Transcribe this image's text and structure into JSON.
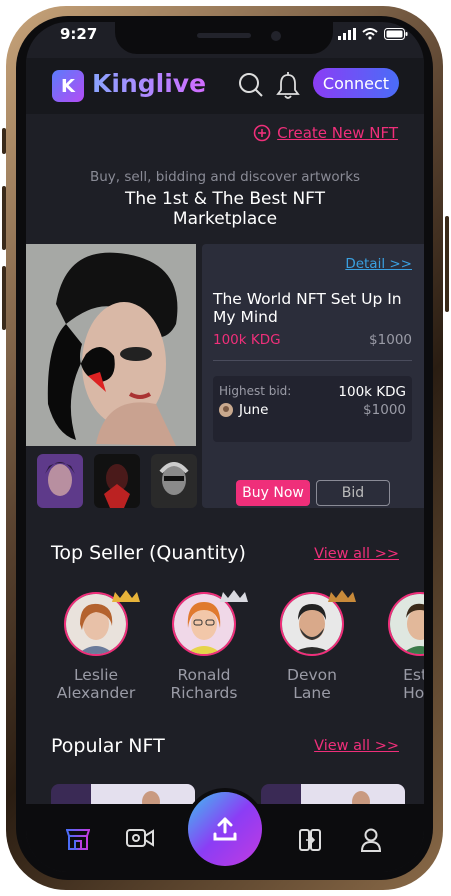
{
  "status_bar": {
    "time": "9:27"
  },
  "header": {
    "brand": "Kinglive",
    "logo_letter": "K",
    "connect_label": "Connect"
  },
  "create_link": "Create New NFT",
  "hero": {
    "tagline": "Buy, sell, bidding and discover artworks",
    "title_line1": "The 1st & The Best NFT",
    "title_line2": "Marketplace"
  },
  "featured": {
    "detail_label": "Detail >>",
    "title": "The World NFT Set Up In My Mind",
    "price_kdg": "100k KDG",
    "price_usd": "$1000",
    "highest_bid_label": "Highest bid:",
    "bidder": "June",
    "bid_kdg": "100k KDG",
    "bid_usd": "$1000",
    "buy_label": "Buy Now",
    "bid_label": "Bid"
  },
  "top_seller": {
    "title": "Top Seller (Quantity)",
    "view_all": "View all >>",
    "sellers": [
      {
        "first": "Leslie",
        "last": "Alexander",
        "crown_color": "#e7b33a"
      },
      {
        "first": "Ronald",
        "last": "Richards",
        "crown_color": "#d9d9e0"
      },
      {
        "first": "Devon",
        "last": "Lane",
        "crown_color": "#c88a3a"
      },
      {
        "first": "Esth",
        "last": "How"
      }
    ]
  },
  "popular": {
    "title": "Popular NFT",
    "view_all": "View all >>"
  },
  "colors": {
    "accent": "#ef2f7a",
    "link": "#3aa0e0",
    "background": "#1e1f26",
    "card": "#2b2d3a"
  },
  "nav": {
    "icons": [
      "store-icon",
      "video-camera-icon",
      "upload-icon",
      "swap-icon",
      "user-icon"
    ]
  }
}
